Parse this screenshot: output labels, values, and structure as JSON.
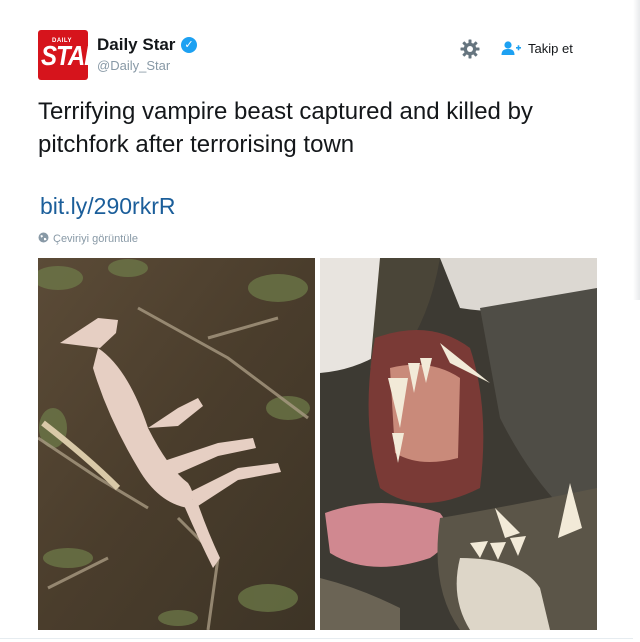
{
  "account": {
    "logo_small": "DAILY",
    "logo_big": "STAR",
    "name": "Daily Star",
    "verified_mark": "✓",
    "handle": "@Daily_Star"
  },
  "actions": {
    "settings_icon": "gear-icon",
    "follow_icon": "add-user-icon",
    "follow_label": "Takip et"
  },
  "tweet": {
    "text": "Terrifying vampire beast captured and killed by pitchfork after terrorising town",
    "link": "bit.ly/290rkrR",
    "translate_label": "Çeviriyi görüntüle"
  },
  "colors": {
    "brand_red": "#d6141c",
    "verified_blue": "#1da1f2",
    "link_blue": "#1b5e9a",
    "muted_gray": "#8899a6"
  }
}
